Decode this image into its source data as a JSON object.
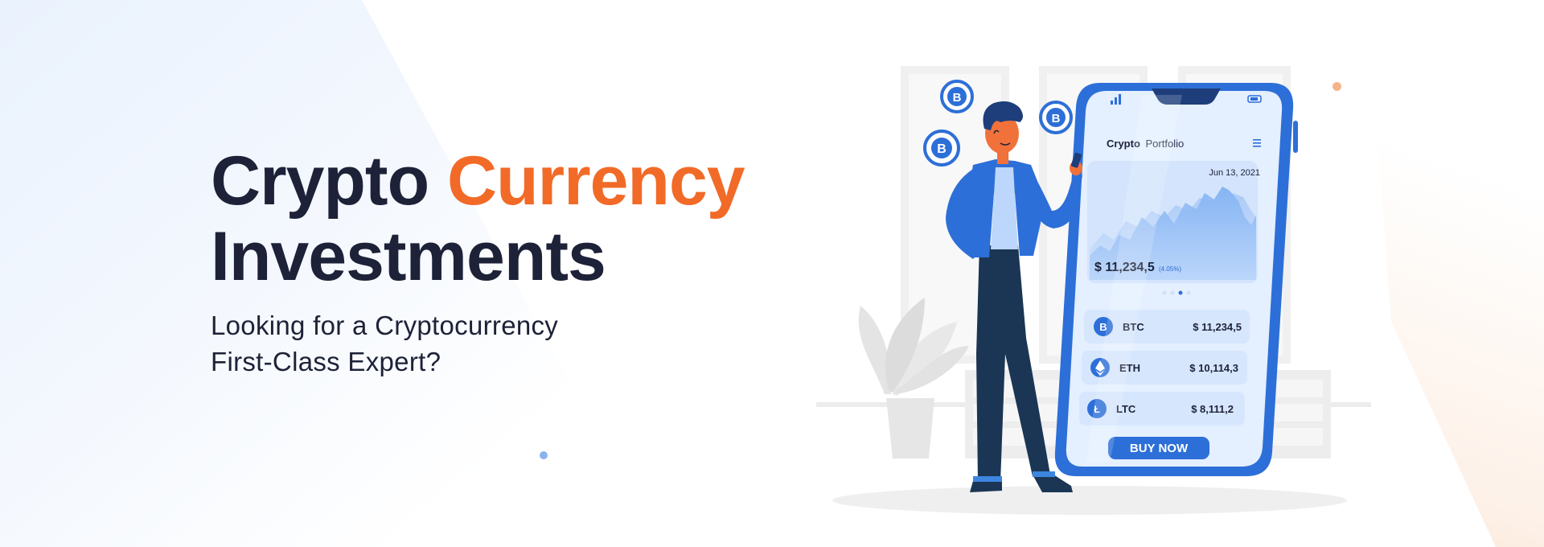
{
  "headline": {
    "line1_part1": "Crypto",
    "line1_part2": "Currency",
    "line2": "Investments"
  },
  "subheadline": {
    "line1": "Looking for a Cryptocurrency",
    "line2": "First-Class Expert?"
  },
  "phone": {
    "title_bold": "Crypto",
    "title_light": "Portfolio",
    "menu_icon": "hamburger-icon",
    "date": "Jun 13, 2021",
    "balance": "$ 11,234,5",
    "balance_change": "(4.05%)",
    "coins": [
      {
        "symbol": "BTC",
        "price": "$ 11,234,5",
        "icon": "bitcoin-icon"
      },
      {
        "symbol": "ETH",
        "price": "$ 10,114,3",
        "icon": "ethereum-icon"
      },
      {
        "symbol": "LTC",
        "price": "$ 8,111,2",
        "icon": "litecoin-icon"
      }
    ],
    "button_label": "BUY NOW"
  },
  "colors": {
    "dark": "#1d2238",
    "accent_orange": "#f26a27",
    "phone_blue": "#2d6fd8",
    "screen_bg": "#e4efff"
  }
}
